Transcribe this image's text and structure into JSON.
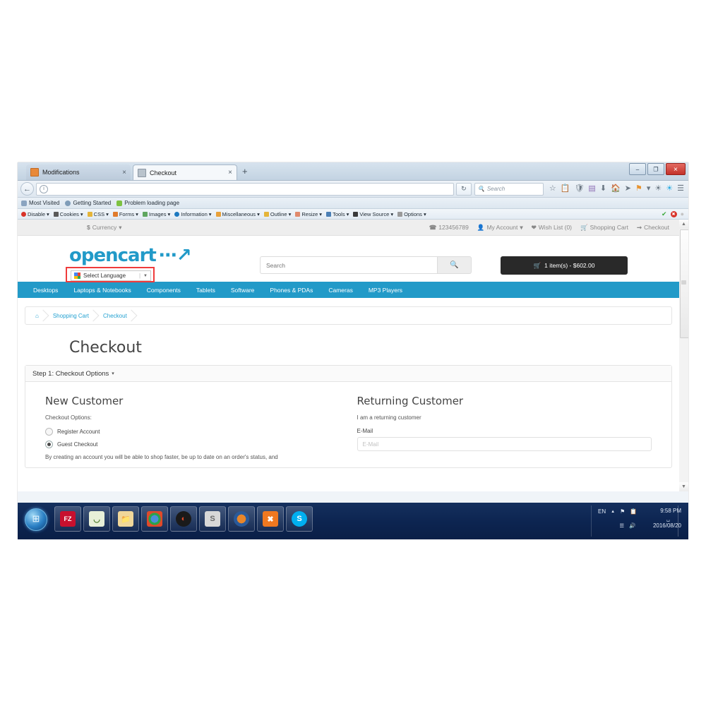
{
  "browser": {
    "tabs": [
      {
        "title": "Modifications",
        "favicon": "orange-page-icon",
        "close": "×",
        "active": false
      },
      {
        "title": "Checkout",
        "favicon": "cart-icon",
        "close": "×",
        "active": true
      }
    ],
    "new_tab_label": "+",
    "window_controls": {
      "minimize": "–",
      "maximize": "❐",
      "close": "✕"
    },
    "nav": {
      "back": "←",
      "url_value": "",
      "url_placeholder": "",
      "reload": "↻",
      "search_placeholder": "Search",
      "search_icon": "🔍"
    },
    "toolbar_icons": [
      "star-icon",
      "clipboard-icon",
      "shield-icon",
      "print-icon",
      "download-icon",
      "home-icon",
      "send-icon",
      "flag-icon",
      "chevron-down-icon",
      "globe-icon",
      "skype-icon",
      "hamburger-menu-icon"
    ],
    "bookmarks": [
      {
        "label": "Most Visited",
        "icon": "bookmark-icon",
        "color": "#8aa4c0"
      },
      {
        "label": "Getting Started",
        "icon": "firefox-icon",
        "color": "#7f9db9"
      },
      {
        "label": "Problem loading page",
        "icon": "page-icon",
        "color": "#7dc242"
      }
    ],
    "devtoolbar": [
      {
        "label": "Disable",
        "color": "#d8332a"
      },
      {
        "label": "Cookies",
        "color": "#5a5a5a"
      },
      {
        "label": "CSS",
        "color": "#e5b53a"
      },
      {
        "label": "Forms",
        "color": "#e07b2c"
      },
      {
        "label": "Images",
        "color": "#5fa65f"
      },
      {
        "label": "Information",
        "color": "#1c79c0"
      },
      {
        "label": "Miscellaneous",
        "color": "#e8a13a"
      },
      {
        "label": "Outline",
        "color": "#e5b53a"
      },
      {
        "label": "Resize",
        "color": "#e08a6d"
      },
      {
        "label": "Tools",
        "color": "#4a7fb5"
      },
      {
        "label": "View Source",
        "color": "#3a3a3a"
      },
      {
        "label": "Options",
        "color": "#9a9a9a"
      }
    ],
    "devtoolbar_status": {
      "ok": "✔",
      "error": "✖",
      "idle": "●"
    }
  },
  "store": {
    "topbar": {
      "currency_label": "Currency",
      "currency_symbol": "$",
      "phone": "123456789",
      "phone_icon": "phone-icon",
      "my_account": "My Account",
      "wish_list": "Wish List (0)",
      "shopping_cart": "Shopping Cart",
      "checkout": "Checkout"
    },
    "logo_text": "opencart",
    "translate_widget": {
      "label": "Select Language",
      "separator": "|",
      "caret": "▼",
      "highlight_color": "#ef3b3b"
    },
    "search": {
      "placeholder": "Search",
      "button_icon": "search-icon"
    },
    "cart_button": {
      "icon": "cart-icon",
      "label": "1 item(s) - $602.00"
    },
    "nav_menu": [
      "Desktops",
      "Laptops & Notebooks",
      "Components",
      "Tablets",
      "Software",
      "Phones & PDAs",
      "Cameras",
      "MP3 Players"
    ],
    "breadcrumbs": [
      {
        "label": "⌂",
        "name": "home"
      },
      {
        "label": "Shopping Cart",
        "name": "shopping-cart"
      },
      {
        "label": "Checkout",
        "name": "checkout"
      }
    ],
    "page_title": "Checkout",
    "panel": {
      "step_title": "Step 1: Checkout Options",
      "caret": "▾",
      "new_customer": {
        "heading": "New Customer",
        "lead": "Checkout Options:",
        "options": [
          {
            "label": "Register Account",
            "selected": false
          },
          {
            "label": "Guest Checkout",
            "selected": true
          }
        ],
        "paragraph": "By creating an account you will be able to shop faster, be up to date on an order's status, and"
      },
      "returning_customer": {
        "heading": "Returning Customer",
        "lead": "I am a returning customer",
        "email_label": "E-Mail",
        "email_placeholder": "E-Mail"
      }
    },
    "accent_color": "#229ac8"
  },
  "taskbar": {
    "start_label": "Start",
    "apps": [
      {
        "name": "filezilla",
        "glyph": "FZ",
        "bg": "#c8102e",
        "fg": "#ffffff"
      },
      {
        "name": "image-viewer",
        "glyph": "◤",
        "bg": "#e8f0d8",
        "fg": "#4a7a2a"
      },
      {
        "name": "file-explorer",
        "glyph": "🖿",
        "bg": "#f0d79a",
        "fg": "#a07828"
      },
      {
        "name": "google-chrome",
        "glyph": "●",
        "bg": "#ffffff",
        "fg": "#2a8cd8"
      },
      {
        "name": "photoshop-tool",
        "glyph": "◐",
        "bg": "#1a1a1a",
        "fg": "#e04a2a"
      },
      {
        "name": "sublime-text",
        "glyph": "S",
        "bg": "#d8d8d8",
        "fg": "#6a6a6a"
      },
      {
        "name": "mozilla-firefox",
        "glyph": "●",
        "bg": "#2a5a9a",
        "fg": "#e8862a"
      },
      {
        "name": "xampp",
        "glyph": "✖",
        "bg": "#f07820",
        "fg": "#ffffff"
      },
      {
        "name": "skype",
        "glyph": "S",
        "bg": "#00aff0",
        "fg": "#ffffff"
      }
    ],
    "tray": {
      "language": "EN",
      "arrow": "▲",
      "flag_icon": "flag-icon",
      "action_center_icon": "clipboard-icon",
      "network_icon": "signal-icon",
      "volume_icon": "speaker-icon",
      "keyboard_icon": "keyboard-icon",
      "time": "9:58 PM",
      "date": "2016/08/20"
    }
  }
}
